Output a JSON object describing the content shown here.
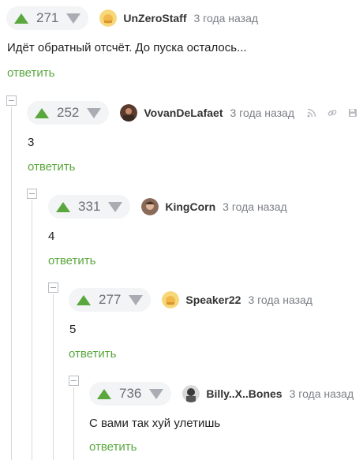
{
  "thread": {
    "reply_label": "ответить",
    "comments": [
      {
        "score": "271",
        "user": "UnZeroStaff",
        "time": "3 года назад",
        "text": "Идёт обратный отсчёт. До пуска осталось..."
      },
      {
        "score": "252",
        "user": "VovanDeLafaet",
        "time": "3 года назад",
        "text": "3"
      },
      {
        "score": "331",
        "user": "KingCorn",
        "time": "3 года назад",
        "text": "4"
      },
      {
        "score": "277",
        "user": "Speaker22",
        "time": "3 года назад",
        "text": "5"
      },
      {
        "score": "736",
        "user": "Billy..X..Bones",
        "time": "3 года назад",
        "text": "С вами так хуй улетишь"
      }
    ]
  },
  "icons": {
    "upvote": "arrow-up-icon",
    "downvote": "arrow-down-icon",
    "collapse": "minus-square-icon",
    "tools": [
      "rss-icon",
      "link-icon",
      "save-icon"
    ]
  },
  "colors": {
    "accent_green": "#59a73d",
    "muted_gray": "#a9adb3",
    "rating_bg": "#f3f4f6"
  }
}
